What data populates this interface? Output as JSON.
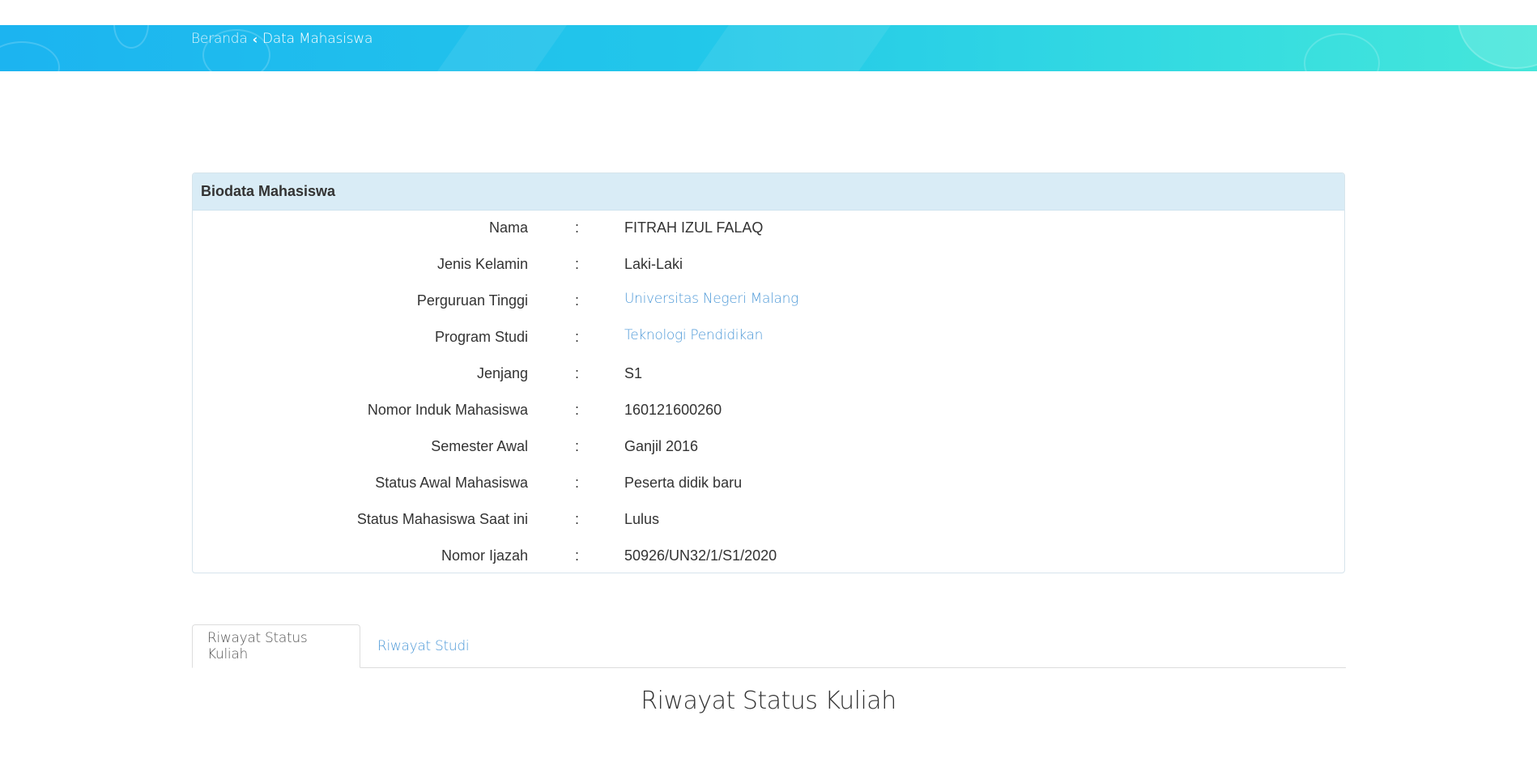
{
  "breadcrumb": {
    "home": "Beranda",
    "separator_icon": "chevron-left-icon",
    "current": "Data Mahasiswa"
  },
  "panel": {
    "title": "Biodata Mahasiswa",
    "rows": [
      {
        "label": "Nama",
        "colon": ":",
        "value": "FITRAH IZUL FALAQ"
      },
      {
        "label": "Jenis Kelamin",
        "colon": ":",
        "value": "Laki-Laki"
      },
      {
        "label": "Perguruan Tinggi",
        "colon": ":",
        "value": "Universitas Negeri Malang"
      },
      {
        "label": "Program Studi",
        "colon": ":",
        "value": "Teknologi Pendidikan"
      },
      {
        "label": "Jenjang",
        "colon": ":",
        "value": "S1"
      },
      {
        "label": "Nomor Induk Mahasiswa",
        "colon": ":",
        "value": "160121600260"
      },
      {
        "label": "Semester Awal",
        "colon": ":",
        "value": "Ganjil 2016"
      },
      {
        "label": "Status Awal Mahasiswa",
        "colon": ":",
        "value": "Peserta didik baru"
      },
      {
        "label": "Status Mahasiswa Saat ini",
        "colon": ":",
        "value": "Lulus"
      },
      {
        "label": "Nomor Ijazah",
        "colon": ":",
        "value": "50926/UN32/1/S1/2020"
      }
    ]
  },
  "tabs": [
    {
      "label": "Riwayat Status Kuliah",
      "active": true
    },
    {
      "label": "Riwayat Studi",
      "active": false
    }
  ],
  "section_title": "Riwayat Status Kuliah",
  "colors": {
    "banner_start": "#1cb4f0",
    "banner_end": "#45e6da",
    "panel_heading_bg": "#d9ecf6",
    "link": "#4f9ad8"
  }
}
